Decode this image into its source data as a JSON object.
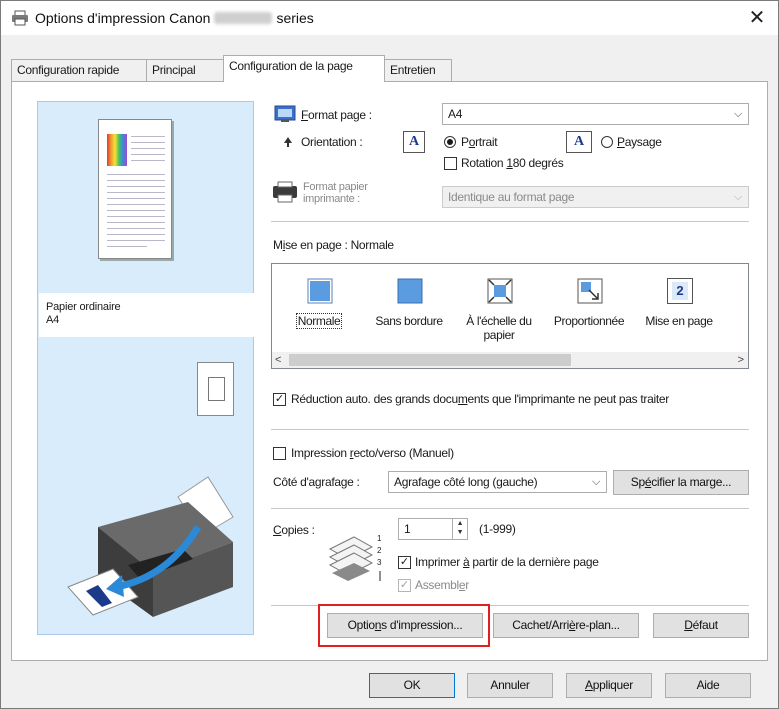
{
  "window": {
    "title_prefix": "Options d'impression Canon",
    "title_suffix": "series",
    "close_glyph": "✕"
  },
  "tabs": [
    {
      "label": "Configuration rapide",
      "active": false
    },
    {
      "label": "Principal",
      "active": false
    },
    {
      "label": "Configuration de la page",
      "active": true
    },
    {
      "label": "Entretien",
      "active": false
    }
  ],
  "preview": {
    "paper_type": "Papier ordinaire",
    "paper_size": "A4"
  },
  "page_setup": {
    "format_label_pre": "",
    "format_label_u": "F",
    "format_label_post": "ormat page :",
    "format_value": "A4",
    "orientation_label": "Orientation :",
    "portrait_pre": "P",
    "portrait_u": "o",
    "portrait_post": "rtrait",
    "landscape_pre": "",
    "landscape_u": "P",
    "landscape_post": "aysage",
    "rotation_pre": "Rotation ",
    "rotation_u": "1",
    "rotation_post": "80 degrés",
    "printer_paper_label_1": "Format papier",
    "printer_paper_label_2": "imprimante :",
    "printer_paper_value": "Identique au format page",
    "orientation_icon_glyph": "A"
  },
  "layout": {
    "label_pre": "M",
    "label_u": "i",
    "label_post": "se en page : Normale",
    "items": [
      {
        "label": "Normale",
        "icon": "normal-layout-icon",
        "selected": true
      },
      {
        "label": "Sans bordure",
        "icon": "borderless-layout-icon",
        "selected": false
      },
      {
        "label_1": "À l'échelle du",
        "label_2": "papier",
        "icon": "fit-to-page-icon",
        "selected": false
      },
      {
        "label": "Proportionnée",
        "icon": "scaled-layout-icon",
        "selected": false
      },
      {
        "label": "Mise en page",
        "icon": "page-layout-icon",
        "badge": "2",
        "selected": false
      }
    ],
    "scroll_left": "<",
    "scroll_right": ">"
  },
  "auto_reduce": {
    "label_pre": "Réduction auto. des grands docu",
    "label_u": "m",
    "label_post": "ents que l'imprimante ne peut pas traiter",
    "checked": true
  },
  "duplex": {
    "label_pre": "Impression ",
    "label_u": "r",
    "label_post": "ecto/verso (Manuel)",
    "checked": false,
    "staple_label": "Côté d'agrafage :",
    "staple_value": "Agrafage côté long (gauche)",
    "margin_button_pre": "Sp",
    "margin_button_u": "é",
    "margin_button_post": "cifier la marge..."
  },
  "copies": {
    "label_pre": "",
    "label_u": "C",
    "label_post": "opies :",
    "value": "1",
    "range": "(1-999)",
    "last_page_pre": "Imprimer ",
    "last_page_u": "à",
    "last_page_post": " partir de la dernière page",
    "last_page_checked": true,
    "collate_pre": "Assembl",
    "collate_u": "e",
    "collate_post": "r",
    "collate_checked": true
  },
  "bottom_buttons": {
    "print_options_pre": "Optio",
    "print_options_u": "n",
    "print_options_post": "s d'impression...",
    "stamp_pre": "Cachet/Arri",
    "stamp_u": "è",
    "stamp_post": "re-plan...",
    "default_pre": "",
    "default_u": "D",
    "default_post": "éfaut"
  },
  "dialog_buttons": {
    "ok": "OK",
    "cancel": "Annuler",
    "apply_pre": "",
    "apply_u": "A",
    "apply_post": "ppliquer",
    "help": "Aide"
  },
  "colors": {
    "highlight": "#e02020",
    "preview_bg": "#d9ecfb",
    "accent": "#0078d7"
  }
}
